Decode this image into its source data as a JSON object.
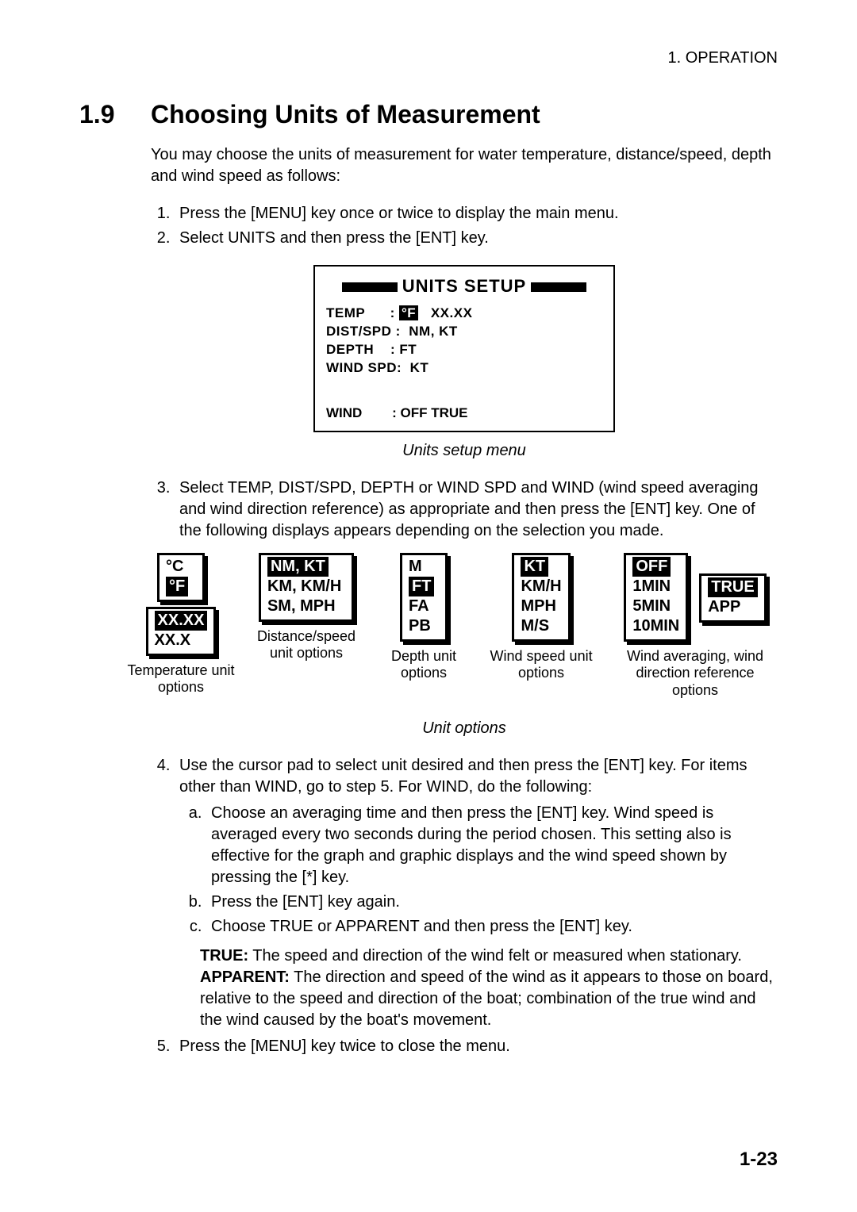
{
  "runningHead": "1. OPERATION",
  "section": {
    "number": "1.9",
    "title": "Choosing Units of Measurement"
  },
  "intro": "You may choose the units of measurement for water temperature, distance/speed, depth and wind speed as follows:",
  "steps": {
    "s1": "Press the [MENU] key once or twice to display the main menu.",
    "s2": "Select UNITS and then press the [ENT] key.",
    "s3": "Select TEMP, DIST/SPD, DEPTH or WIND SPD and WIND (wind speed averaging and wind direction reference) as appropriate and then press the [ENT] key. One of the following displays appears depending on the selection you made.",
    "s4": "Use the cursor pad to select unit desired and then press the [ENT] key. For items other than WIND, go to step 5. For WIND, do the following:",
    "s4a": "Choose an averaging time and then press the [ENT] key. Wind speed is averaged every two seconds during the period chosen. This setting also is effective for the graph and graphic displays and the wind speed shown by pressing the [*] key.",
    "s4b": "Press the [ENT] key again.",
    "s4c": "Choose TRUE or APPARENT and then press the [ENT] key.",
    "s5": "Press the [MENU] key twice to close the menu."
  },
  "setupBox": {
    "title": "UNITS SETUP",
    "rows": {
      "temp_label": "TEMP",
      "temp_sel": "°F",
      "temp_val": "XX.XX",
      "dist_label": "DIST/SPD :",
      "dist_val": "NM, KT",
      "depth_label": "DEPTH",
      "depth_val": ": FT",
      "wspd_label": "WIND SPD:",
      "wspd_val": "KT",
      "wind_label": "WIND",
      "wind_val": ": OFF TRUE"
    }
  },
  "figcap1": "Units setup menu",
  "figcap2": "Unit options",
  "optboxes": {
    "temp_scale": {
      "c": "°C",
      "f": "°F"
    },
    "temp_fmt": {
      "xxxx": "XX.XX",
      "xxx": "XX.X"
    },
    "temp_caption": "Temperature unit options",
    "dist": {
      "nmkt": "NM, KT",
      "kmkmh": "KM, KM/H",
      "smmph": "SM, MPH"
    },
    "dist_caption": "Distance/speed unit options",
    "depth": {
      "m": "M",
      "ft": "FT",
      "fa": "FA",
      "pb": "PB"
    },
    "depth_caption": "Depth unit options",
    "wspd": {
      "kt": "KT",
      "kmh": "KM/H",
      "mph": "MPH",
      "ms": "M/S"
    },
    "wspd_caption": "Wind speed unit options",
    "windavg": {
      "off": "OFF",
      "m1": "1MIN",
      "m5": "5MIN",
      "m10": "10MIN"
    },
    "windref": {
      "true": "TRUE",
      "app": "APP"
    },
    "wind_caption": "Wind averaging, wind direction reference options"
  },
  "defs": {
    "true_label": "TRUE:",
    "true_text": " The speed and direction of the wind felt or measured when stationary.",
    "app_label": "APPARENT:",
    "app_text": " The direction and speed of the wind as it appears to those on board, relative to the speed and direction of the boat; combination of the true wind and the wind caused by the boat's movement."
  },
  "pageNumber": "1-23"
}
